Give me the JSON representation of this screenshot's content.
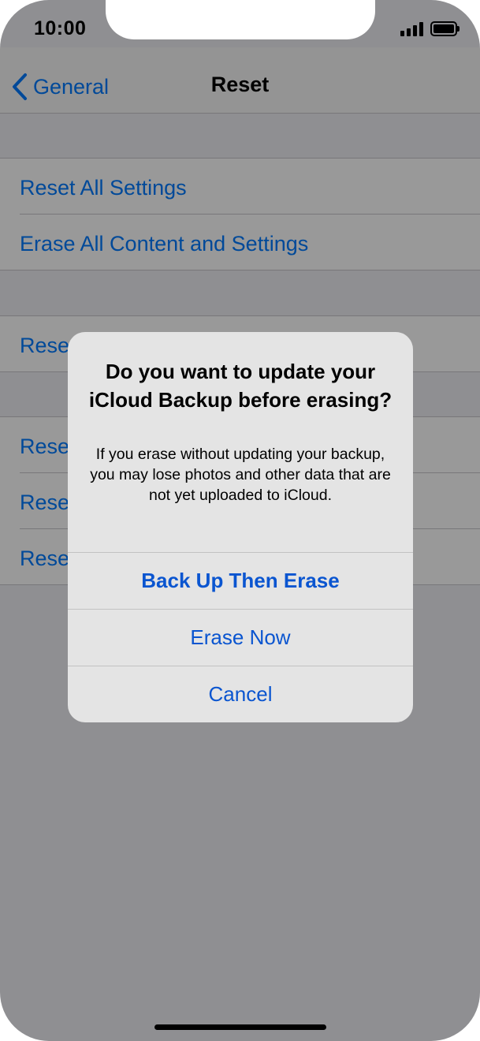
{
  "status_bar": {
    "time": "10:00"
  },
  "navbar": {
    "back_label": "General",
    "title": "Reset"
  },
  "rows": {
    "reset_all_settings": "Reset All Settings",
    "erase_all_content": "Erase All Content and Settings",
    "partial_1": "Reset",
    "partial_2": "Rese",
    "partial_3": "Rese",
    "partial_4": "Rese"
  },
  "alert": {
    "title": "Do you want to update your iCloud Backup before erasing?",
    "message": "If you erase without updating your backup, you may lose photos and other data that are not yet uploaded to iCloud.",
    "buttons": {
      "backup_then_erase": "Back Up Then Erase",
      "erase_now": "Erase Now",
      "cancel": "Cancel"
    }
  },
  "colors": {
    "accent": "#007aff",
    "alert_button": "#0a55d0",
    "group_background": "#efeff4"
  }
}
